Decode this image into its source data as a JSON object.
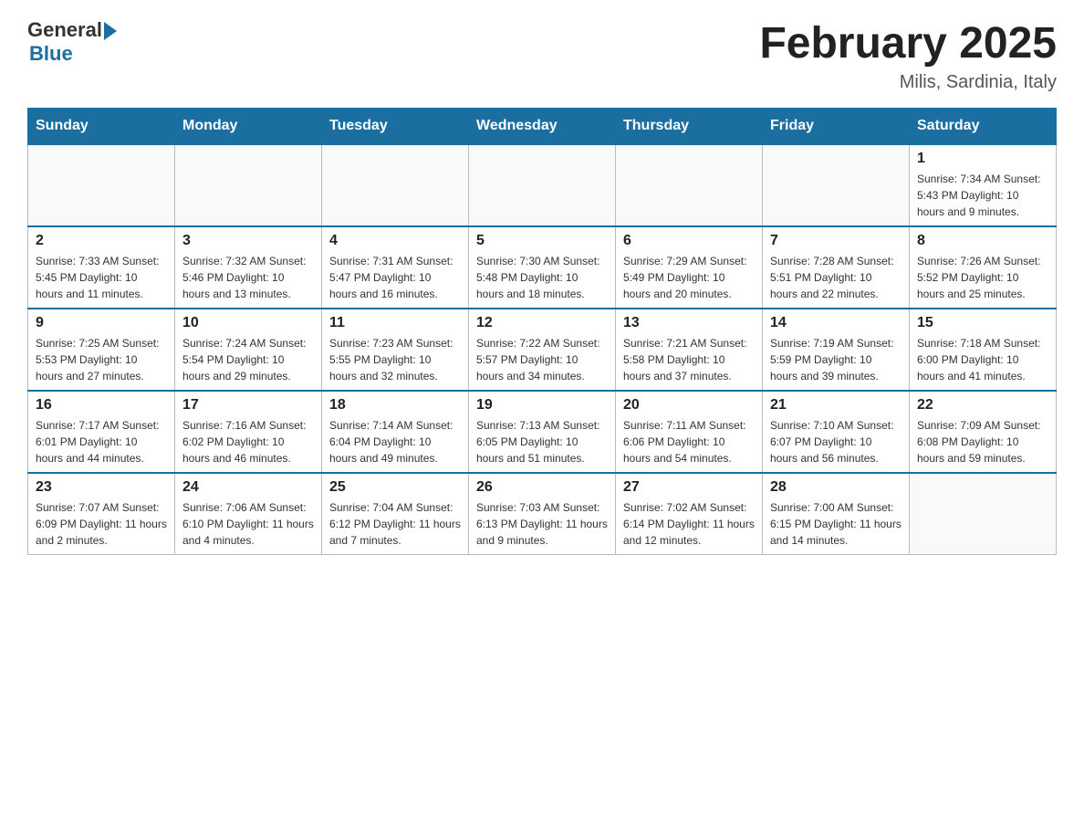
{
  "header": {
    "logo_general": "General",
    "logo_blue": "Blue",
    "month_title": "February 2025",
    "location": "Milis, Sardinia, Italy"
  },
  "weekdays": [
    "Sunday",
    "Monday",
    "Tuesday",
    "Wednesday",
    "Thursday",
    "Friday",
    "Saturday"
  ],
  "weeks": [
    [
      {
        "day": "",
        "info": ""
      },
      {
        "day": "",
        "info": ""
      },
      {
        "day": "",
        "info": ""
      },
      {
        "day": "",
        "info": ""
      },
      {
        "day": "",
        "info": ""
      },
      {
        "day": "",
        "info": ""
      },
      {
        "day": "1",
        "info": "Sunrise: 7:34 AM\nSunset: 5:43 PM\nDaylight: 10 hours and 9 minutes."
      }
    ],
    [
      {
        "day": "2",
        "info": "Sunrise: 7:33 AM\nSunset: 5:45 PM\nDaylight: 10 hours and 11 minutes."
      },
      {
        "day": "3",
        "info": "Sunrise: 7:32 AM\nSunset: 5:46 PM\nDaylight: 10 hours and 13 minutes."
      },
      {
        "day": "4",
        "info": "Sunrise: 7:31 AM\nSunset: 5:47 PM\nDaylight: 10 hours and 16 minutes."
      },
      {
        "day": "5",
        "info": "Sunrise: 7:30 AM\nSunset: 5:48 PM\nDaylight: 10 hours and 18 minutes."
      },
      {
        "day": "6",
        "info": "Sunrise: 7:29 AM\nSunset: 5:49 PM\nDaylight: 10 hours and 20 minutes."
      },
      {
        "day": "7",
        "info": "Sunrise: 7:28 AM\nSunset: 5:51 PM\nDaylight: 10 hours and 22 minutes."
      },
      {
        "day": "8",
        "info": "Sunrise: 7:26 AM\nSunset: 5:52 PM\nDaylight: 10 hours and 25 minutes."
      }
    ],
    [
      {
        "day": "9",
        "info": "Sunrise: 7:25 AM\nSunset: 5:53 PM\nDaylight: 10 hours and 27 minutes."
      },
      {
        "day": "10",
        "info": "Sunrise: 7:24 AM\nSunset: 5:54 PM\nDaylight: 10 hours and 29 minutes."
      },
      {
        "day": "11",
        "info": "Sunrise: 7:23 AM\nSunset: 5:55 PM\nDaylight: 10 hours and 32 minutes."
      },
      {
        "day": "12",
        "info": "Sunrise: 7:22 AM\nSunset: 5:57 PM\nDaylight: 10 hours and 34 minutes."
      },
      {
        "day": "13",
        "info": "Sunrise: 7:21 AM\nSunset: 5:58 PM\nDaylight: 10 hours and 37 minutes."
      },
      {
        "day": "14",
        "info": "Sunrise: 7:19 AM\nSunset: 5:59 PM\nDaylight: 10 hours and 39 minutes."
      },
      {
        "day": "15",
        "info": "Sunrise: 7:18 AM\nSunset: 6:00 PM\nDaylight: 10 hours and 41 minutes."
      }
    ],
    [
      {
        "day": "16",
        "info": "Sunrise: 7:17 AM\nSunset: 6:01 PM\nDaylight: 10 hours and 44 minutes."
      },
      {
        "day": "17",
        "info": "Sunrise: 7:16 AM\nSunset: 6:02 PM\nDaylight: 10 hours and 46 minutes."
      },
      {
        "day": "18",
        "info": "Sunrise: 7:14 AM\nSunset: 6:04 PM\nDaylight: 10 hours and 49 minutes."
      },
      {
        "day": "19",
        "info": "Sunrise: 7:13 AM\nSunset: 6:05 PM\nDaylight: 10 hours and 51 minutes."
      },
      {
        "day": "20",
        "info": "Sunrise: 7:11 AM\nSunset: 6:06 PM\nDaylight: 10 hours and 54 minutes."
      },
      {
        "day": "21",
        "info": "Sunrise: 7:10 AM\nSunset: 6:07 PM\nDaylight: 10 hours and 56 minutes."
      },
      {
        "day": "22",
        "info": "Sunrise: 7:09 AM\nSunset: 6:08 PM\nDaylight: 10 hours and 59 minutes."
      }
    ],
    [
      {
        "day": "23",
        "info": "Sunrise: 7:07 AM\nSunset: 6:09 PM\nDaylight: 11 hours and 2 minutes."
      },
      {
        "day": "24",
        "info": "Sunrise: 7:06 AM\nSunset: 6:10 PM\nDaylight: 11 hours and 4 minutes."
      },
      {
        "day": "25",
        "info": "Sunrise: 7:04 AM\nSunset: 6:12 PM\nDaylight: 11 hours and 7 minutes."
      },
      {
        "day": "26",
        "info": "Sunrise: 7:03 AM\nSunset: 6:13 PM\nDaylight: 11 hours and 9 minutes."
      },
      {
        "day": "27",
        "info": "Sunrise: 7:02 AM\nSunset: 6:14 PM\nDaylight: 11 hours and 12 minutes."
      },
      {
        "day": "28",
        "info": "Sunrise: 7:00 AM\nSunset: 6:15 PM\nDaylight: 11 hours and 14 minutes."
      },
      {
        "day": "",
        "info": ""
      }
    ]
  ]
}
